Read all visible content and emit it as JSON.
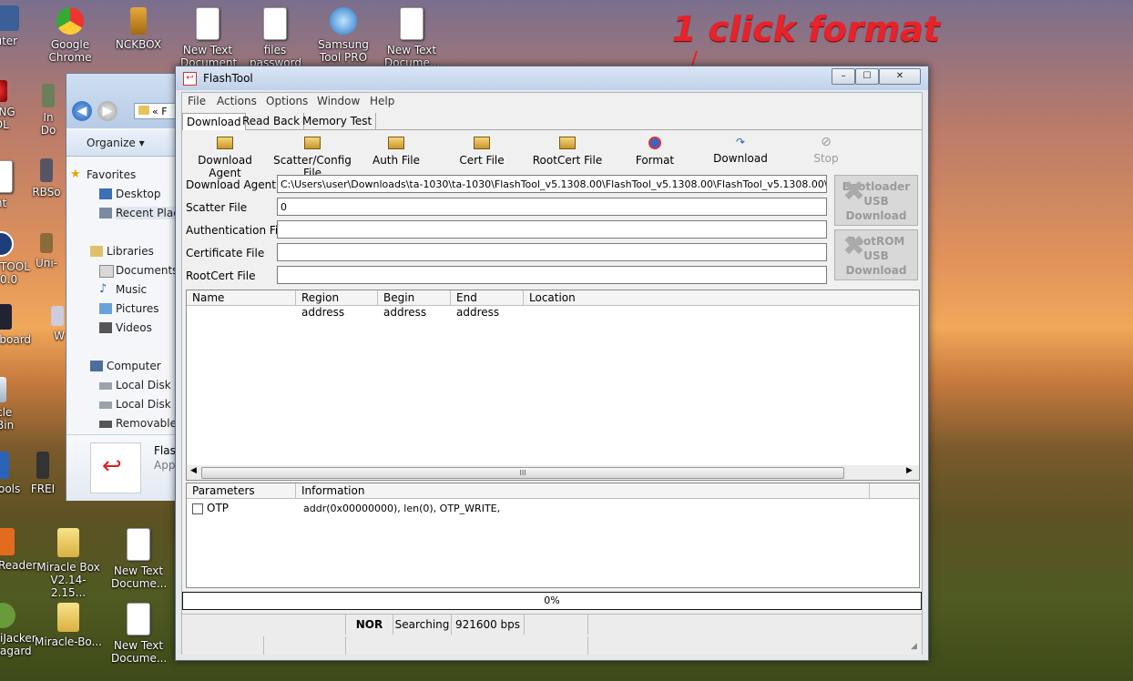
{
  "desktop": {
    "icons": [
      {
        "label": "puter",
        "id": "computer"
      },
      {
        "label": "Google Chrome",
        "id": "chrome"
      },
      {
        "label": "NCKBOX",
        "id": "nckbox"
      },
      {
        "label": "New Text Document",
        "id": "ntd1"
      },
      {
        "label": "files password",
        "id": "files-password"
      },
      {
        "label": "Samsung Tool PRO",
        "id": "samsung-tool"
      },
      {
        "label": "New Text Docume...",
        "id": "ntd2"
      },
      {
        "label": "SUNG OOL",
        "id": "samsung-left"
      },
      {
        "label": "In Do",
        "id": "in-do"
      },
      {
        "label": "nt",
        "id": "nt"
      },
      {
        "label": "RBSo",
        "id": "rbso"
      },
      {
        "label": "TOOL 0.0",
        "id": "tool-00"
      },
      {
        "label": "Uni-",
        "id": "uni"
      },
      {
        "label": "eboard",
        "id": "eboard"
      },
      {
        "label": "W",
        "id": "w"
      },
      {
        "label": "cle Bin",
        "id": "recycle-bin"
      },
      {
        "label": "ools",
        "id": "tools"
      },
      {
        "label": "FREI",
        "id": "frei"
      },
      {
        "label": "Reader",
        "id": "reader"
      },
      {
        "label": "Miracle Box V2.14-2.15...",
        "id": "miracle-box"
      },
      {
        "label": "New Text Docume...",
        "id": "ntd3"
      },
      {
        "label": "iJacker agard",
        "id": "ijacker"
      },
      {
        "label": "Miracle-Bo...",
        "id": "miracle-bo"
      },
      {
        "label": "New Text Docume...",
        "id": "ntd4"
      }
    ]
  },
  "annotation": {
    "text": "1 click format"
  },
  "explorer": {
    "address": "« F",
    "organize": "Organize",
    "nav": [
      {
        "label": "Favorites"
      },
      {
        "label": "Desktop"
      },
      {
        "label": "Recent Place"
      },
      {
        "label": "Libraries"
      },
      {
        "label": "Documents"
      },
      {
        "label": "Music"
      },
      {
        "label": "Pictures"
      },
      {
        "label": "Videos"
      },
      {
        "label": "Computer"
      },
      {
        "label": "Local Disk (C"
      },
      {
        "label": "Local Disk (D"
      },
      {
        "label": "Removable"
      }
    ],
    "details": {
      "name": "Flas",
      "type": "App"
    }
  },
  "flashtool": {
    "title": "FlashTool",
    "window_controls": {
      "minimize": "–",
      "maximize": "☐",
      "close": "✕"
    },
    "menu": [
      "File",
      "Actions",
      "Options",
      "Window",
      "Help"
    ],
    "tabs": [
      "Download",
      "Read Back",
      "Memory Test"
    ],
    "toolbar": {
      "download_agent": "Download Agent",
      "scatter_config": "Scatter/Config File",
      "auth_file": "Auth File",
      "cert_file": "Cert File",
      "rootcert_file": "RootCert File",
      "format": "Format",
      "download": "Download",
      "stop": "Stop"
    },
    "fields": {
      "download_agent_label": "Download Agent",
      "download_agent_value": "C:\\Users\\user\\Downloads\\ta-1030\\ta-1030\\FlashTool_v5.1308.00\\FlashTool_v5.1308.00\\FlashTool_v5.1308.00\\MTK_AllInO",
      "scatter_label": "Scatter File",
      "scatter_value": "0",
      "auth_label": "Authentication File",
      "auth_value": "",
      "cert_label": "Certificate File",
      "cert_value": "",
      "rootcert_label": "RootCert File",
      "rootcert_value": ""
    },
    "bootloader_button": {
      "line1": "Bootloader",
      "line2": "USB",
      "line3": "Download"
    },
    "bootrom_button": {
      "line1": "BootROM",
      "line2": "USB",
      "line3": "Download"
    },
    "region_table": {
      "columns": [
        "Name",
        "Region address",
        "Begin address",
        "End address",
        "Location"
      ]
    },
    "scrollbar_label": "III",
    "param_table": {
      "columns": [
        "Parameters",
        "Information"
      ],
      "rows": [
        {
          "param": "OTP",
          "info": "addr(0x00000000), len(0), OTP_WRITE,",
          "checked": false
        }
      ]
    },
    "progress": {
      "text": "0%",
      "value": 0
    },
    "status": {
      "storage": "NOR",
      "state": "Searching",
      "baud": "921600 bps"
    }
  },
  "colors": {
    "annotation": "#e8222a",
    "titlebar": "#c9d9ee"
  }
}
